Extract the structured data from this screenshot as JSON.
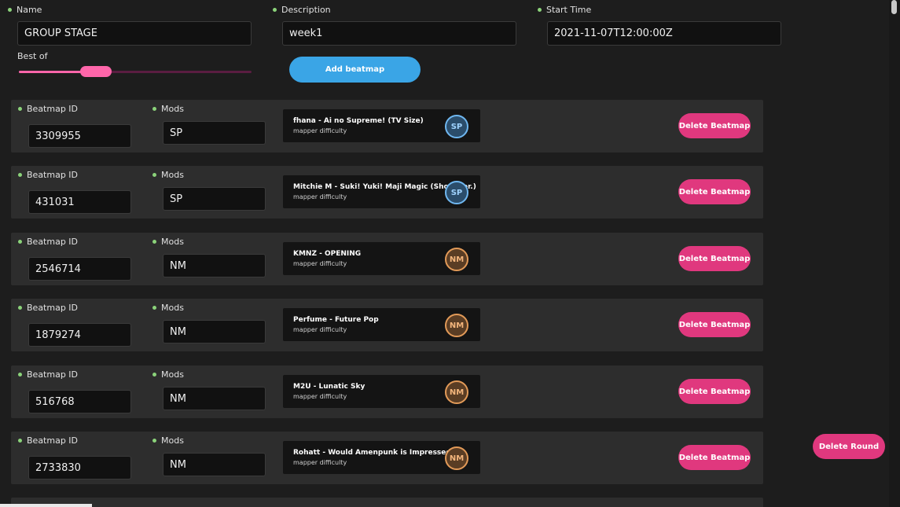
{
  "header": {
    "name_label": "Name",
    "name_value": "GROUP STAGE",
    "description_label": "Description",
    "description_value": "week1",
    "start_time_label": "Start Time",
    "start_time_value": "2021-11-07T12:00:00Z",
    "best_of_label": "Best of",
    "best_of_slider_fraction": 0.33,
    "add_beatmap_label": "Add beatmap"
  },
  "beatmaps": [
    {
      "id_label": "Beatmap ID",
      "id": "3309955",
      "mods_label": "Mods",
      "mods": "SP",
      "title": "fhana - Ai no Supreme! (TV Size)",
      "subtitle": "mapper difficulty",
      "mod_icon": "SP",
      "delete_label": "Delete Beatmap"
    },
    {
      "id_label": "Beatmap ID",
      "id": "431031",
      "mods_label": "Mods",
      "mods": "SP",
      "title": "Mitchie M - Suki! Yuki! Maji Magic (Short Ver.)",
      "subtitle": "mapper difficulty",
      "mod_icon": "SP",
      "delete_label": "Delete Beatmap"
    },
    {
      "id_label": "Beatmap ID",
      "id": "2546714",
      "mods_label": "Mods",
      "mods": "NM",
      "title": "KMNZ - OPENING",
      "subtitle": "mapper difficulty",
      "mod_icon": "NM",
      "delete_label": "Delete Beatmap"
    },
    {
      "id_label": "Beatmap ID",
      "id": "1879274",
      "mods_label": "Mods",
      "mods": "NM",
      "title": "Perfume - Future Pop",
      "subtitle": "mapper difficulty",
      "mod_icon": "NM",
      "delete_label": "Delete Beatmap"
    },
    {
      "id_label": "Beatmap ID",
      "id": "516768",
      "mods_label": "Mods",
      "mods": "NM",
      "title": "M2U - Lunatic Sky",
      "subtitle": "mapper difficulty",
      "mod_icon": "NM",
      "delete_label": "Delete Beatmap"
    },
    {
      "id_label": "Beatmap ID",
      "id": "2733830",
      "mods_label": "Mods",
      "mods": "NM",
      "title": "Rohatt - Would Amenpunk is Impressed",
      "subtitle": "mapper difficulty",
      "mod_icon": "NM",
      "delete_label": "Delete Beatmap"
    }
  ],
  "delete_round_label": "Delete Round",
  "colors": {
    "accent_pink": "#e0387e",
    "accent_blue": "#3aa5e6",
    "slider_pink": "#ff66aa",
    "required_dot": "#8bd37a"
  }
}
